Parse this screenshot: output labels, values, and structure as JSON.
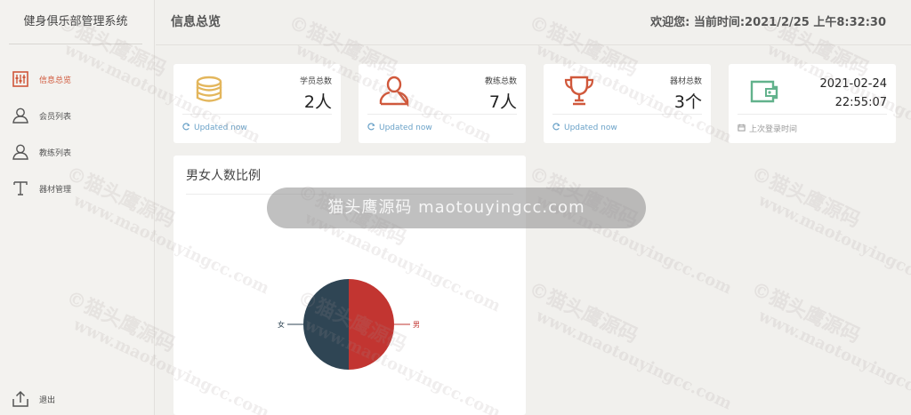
{
  "sidebar": {
    "brand": "健身俱乐部管理系统",
    "items": [
      {
        "label": "信息总览",
        "icon": "dashboard-icon"
      },
      {
        "label": "会员列表",
        "icon": "user-icon"
      },
      {
        "label": "教练列表",
        "icon": "user-icon"
      },
      {
        "label": "器材管理",
        "icon": "text-icon"
      }
    ],
    "logout_label": "退出"
  },
  "header": {
    "title": "信息总览",
    "welcome": "欢迎您:  当前时间:2021/2/25 上午8:32:30"
  },
  "cards": [
    {
      "title": "学员总数",
      "value": "2人",
      "foot": "Updated now",
      "icon": "coins-icon"
    },
    {
      "title": "教练总数",
      "value": "7人",
      "foot": "Updated now",
      "icon": "person-icon"
    },
    {
      "title": "器材总数",
      "value": "3个",
      "foot": "Updated now",
      "icon": "trophy-icon"
    },
    {
      "date": "2021-02-24",
      "time": "22:55:07",
      "foot": "上次登录时间",
      "icon": "wallet-icon"
    }
  ],
  "chart_data": {
    "type": "pie",
    "title": "男女人数比例",
    "series": [
      {
        "name": "男",
        "value": 1,
        "color": "#c23531"
      },
      {
        "name": "女",
        "value": 1,
        "color": "#2f4554"
      }
    ]
  },
  "overlay": "猫头鹰源码 maotouyingcc.com",
  "watermark": {
    "line1": "©猫头鹰源码",
    "line2": "www.maotouyingcc.com"
  },
  "colors": {
    "accent": "#d0583b",
    "link": "#6aa2c8",
    "coin": "#e3b65c",
    "person": "#d0583b",
    "trophy": "#d0583b",
    "wallet": "#62b28c"
  }
}
